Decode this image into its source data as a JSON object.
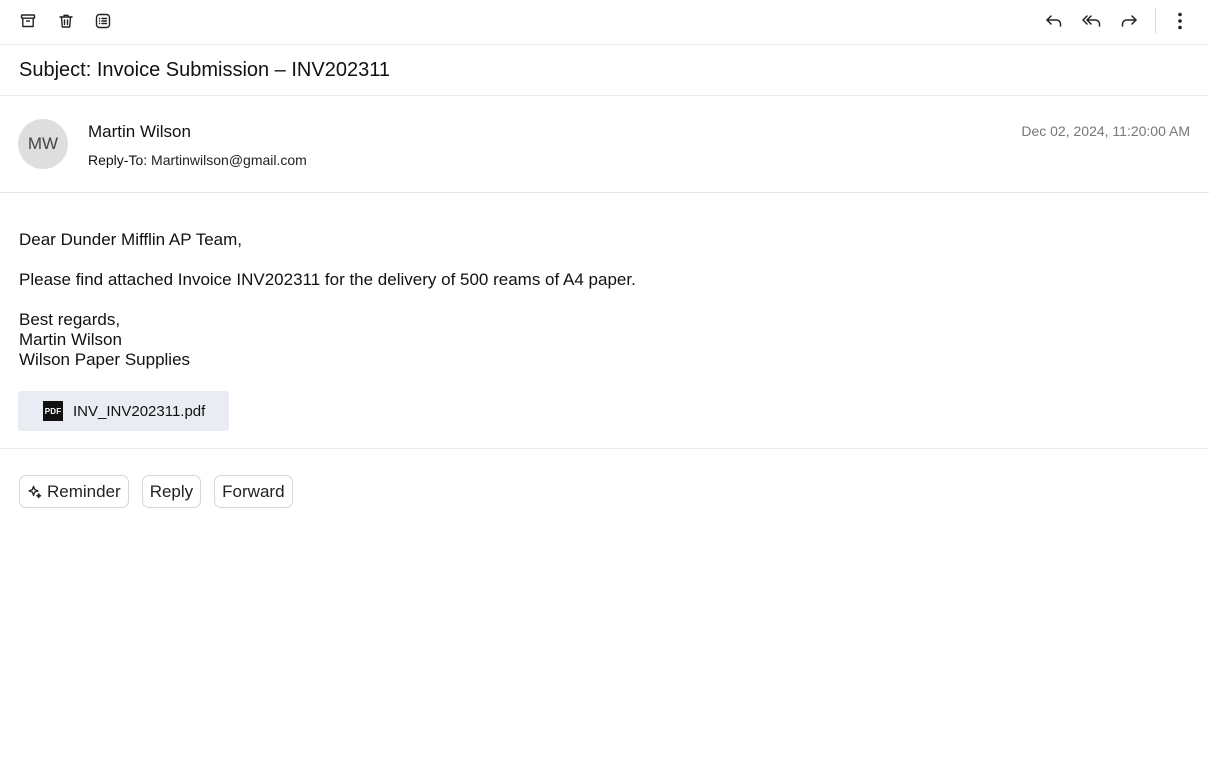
{
  "toolbar": {
    "left_icons": [
      "archive-icon",
      "trash-icon",
      "list-icon"
    ],
    "right_icons": [
      "reply-icon",
      "reply-all-icon",
      "forward-icon",
      "more-vertical-icon"
    ]
  },
  "email": {
    "subject": "Subject: Invoice Submission – INV202311",
    "sender": {
      "initials": "MW",
      "name": "Martin Wilson",
      "reply_to_label": "Reply-To:",
      "reply_to_email": "Martinwilson@gmail.com"
    },
    "date": "Dec 02, 2024, 11:20:00 AM",
    "body": {
      "greeting": "Dear Dunder Mifflin AP Team,",
      "paragraph": "Please find attached Invoice INV202311 for the delivery of 500 reams of A4 paper.",
      "closing": "Best regards,",
      "signature_name": "Martin Wilson",
      "signature_company": "Wilson Paper Supplies"
    },
    "attachment": {
      "icon_label": "PDF",
      "filename": "INV_INV202311.pdf"
    }
  },
  "actions": {
    "reminder": "Reminder",
    "reply": "Reply",
    "forward": "Forward"
  },
  "colors": {
    "attachment_bg": "#e9edf3",
    "avatar_bg": "#dedede",
    "date_text": "#777777"
  }
}
